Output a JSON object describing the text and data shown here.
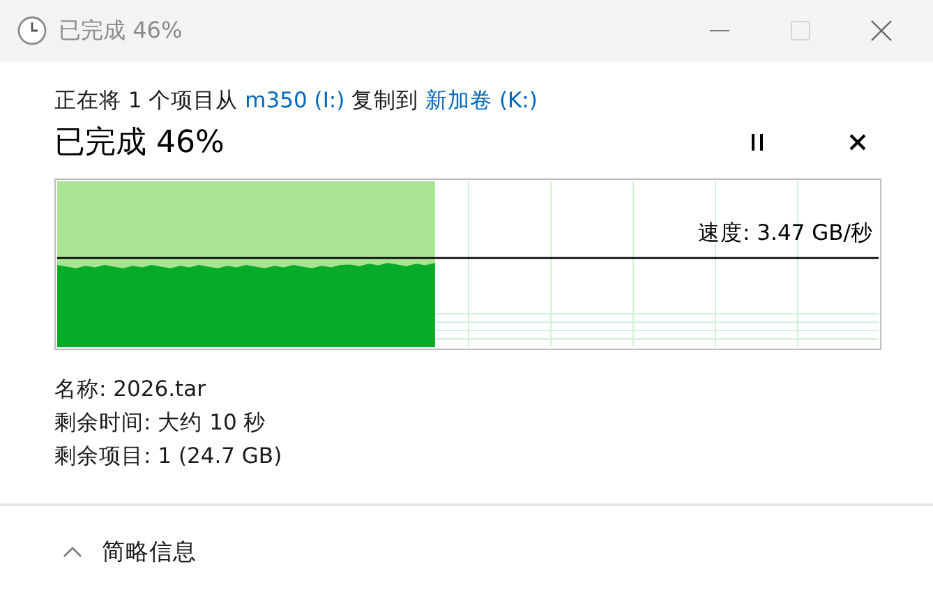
{
  "window": {
    "title": "已完成 46%",
    "maximize_disabled": true
  },
  "header": [
    {
      "kind": "text",
      "text": "正在将 1 个项目从 "
    },
    {
      "kind": "link",
      "text": "m350 (I:)"
    },
    {
      "kind": "text",
      "text": " 复制到 "
    },
    {
      "kind": "link",
      "text": "新加卷 (K:)"
    }
  ],
  "status": "已完成 46%",
  "progress": {
    "level": 0.46,
    "speed": "速度: 3.47 GB/秒"
  },
  "details": [
    "名称: 2026.tar",
    "剩余时间: 大约 10 秒",
    "剩余项目: 1 (24.7 GB)"
  ],
  "footer": {
    "label": "简略信息",
    "expanded": true
  }
}
